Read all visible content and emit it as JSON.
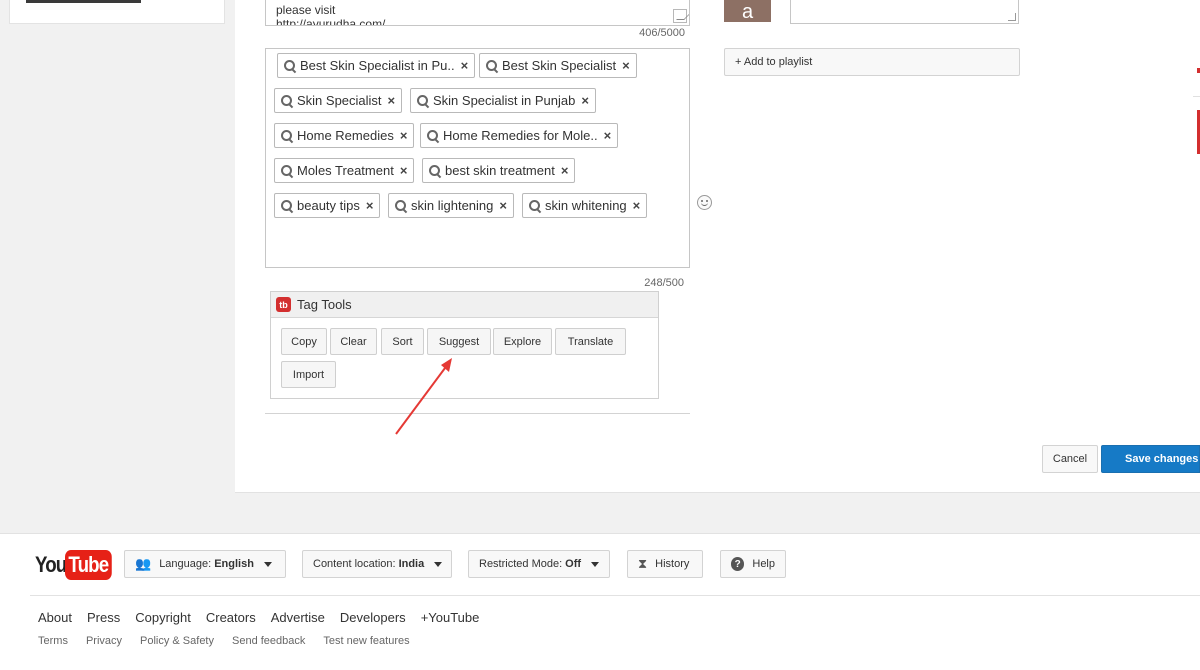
{
  "description": {
    "line1": "please visit",
    "line2": "http://ayurudha.com/",
    "count": "406/5000"
  },
  "tags": {
    "items": [
      "Best Skin Specialist in Pu..",
      "Best Skin Specialist",
      "Skin Specialist",
      "Skin Specialist in Punjab",
      "Home Remedies",
      "Home Remedies for Mole..",
      "Moles Treatment",
      "best skin treatment",
      "beauty tips",
      "skin lightening",
      "skin whitening"
    ],
    "remove_glyph": "×",
    "count": "248/500"
  },
  "tag_tools": {
    "logo": "tb",
    "title": "Tag Tools",
    "buttons": [
      "Copy",
      "Clear",
      "Sort",
      "Suggest",
      "Explore",
      "Translate",
      "Import"
    ]
  },
  "right": {
    "avatar_letter": "a",
    "add_playlist": "+ Add to playlist",
    "cancel": "Cancel",
    "save": "Save changes"
  },
  "footer": {
    "logo_you": "You",
    "logo_tube": "Tube",
    "language_label": "Language:",
    "language_value": "English",
    "location_label": "Content location:",
    "location_value": "India",
    "restricted_label": "Restricted Mode:",
    "restricted_value": "Off",
    "history": "History",
    "help": "Help",
    "links_primary": [
      "About",
      "Press",
      "Copyright",
      "Creators",
      "Advertise",
      "Developers",
      "+YouTube"
    ],
    "links_secondary": [
      "Terms",
      "Privacy",
      "Policy & Safety",
      "Send feedback",
      "Test new features"
    ]
  },
  "colors": {
    "brand_red": "#e62117",
    "save_blue": "#167ac6",
    "annotation_arrow": "#e53935"
  }
}
